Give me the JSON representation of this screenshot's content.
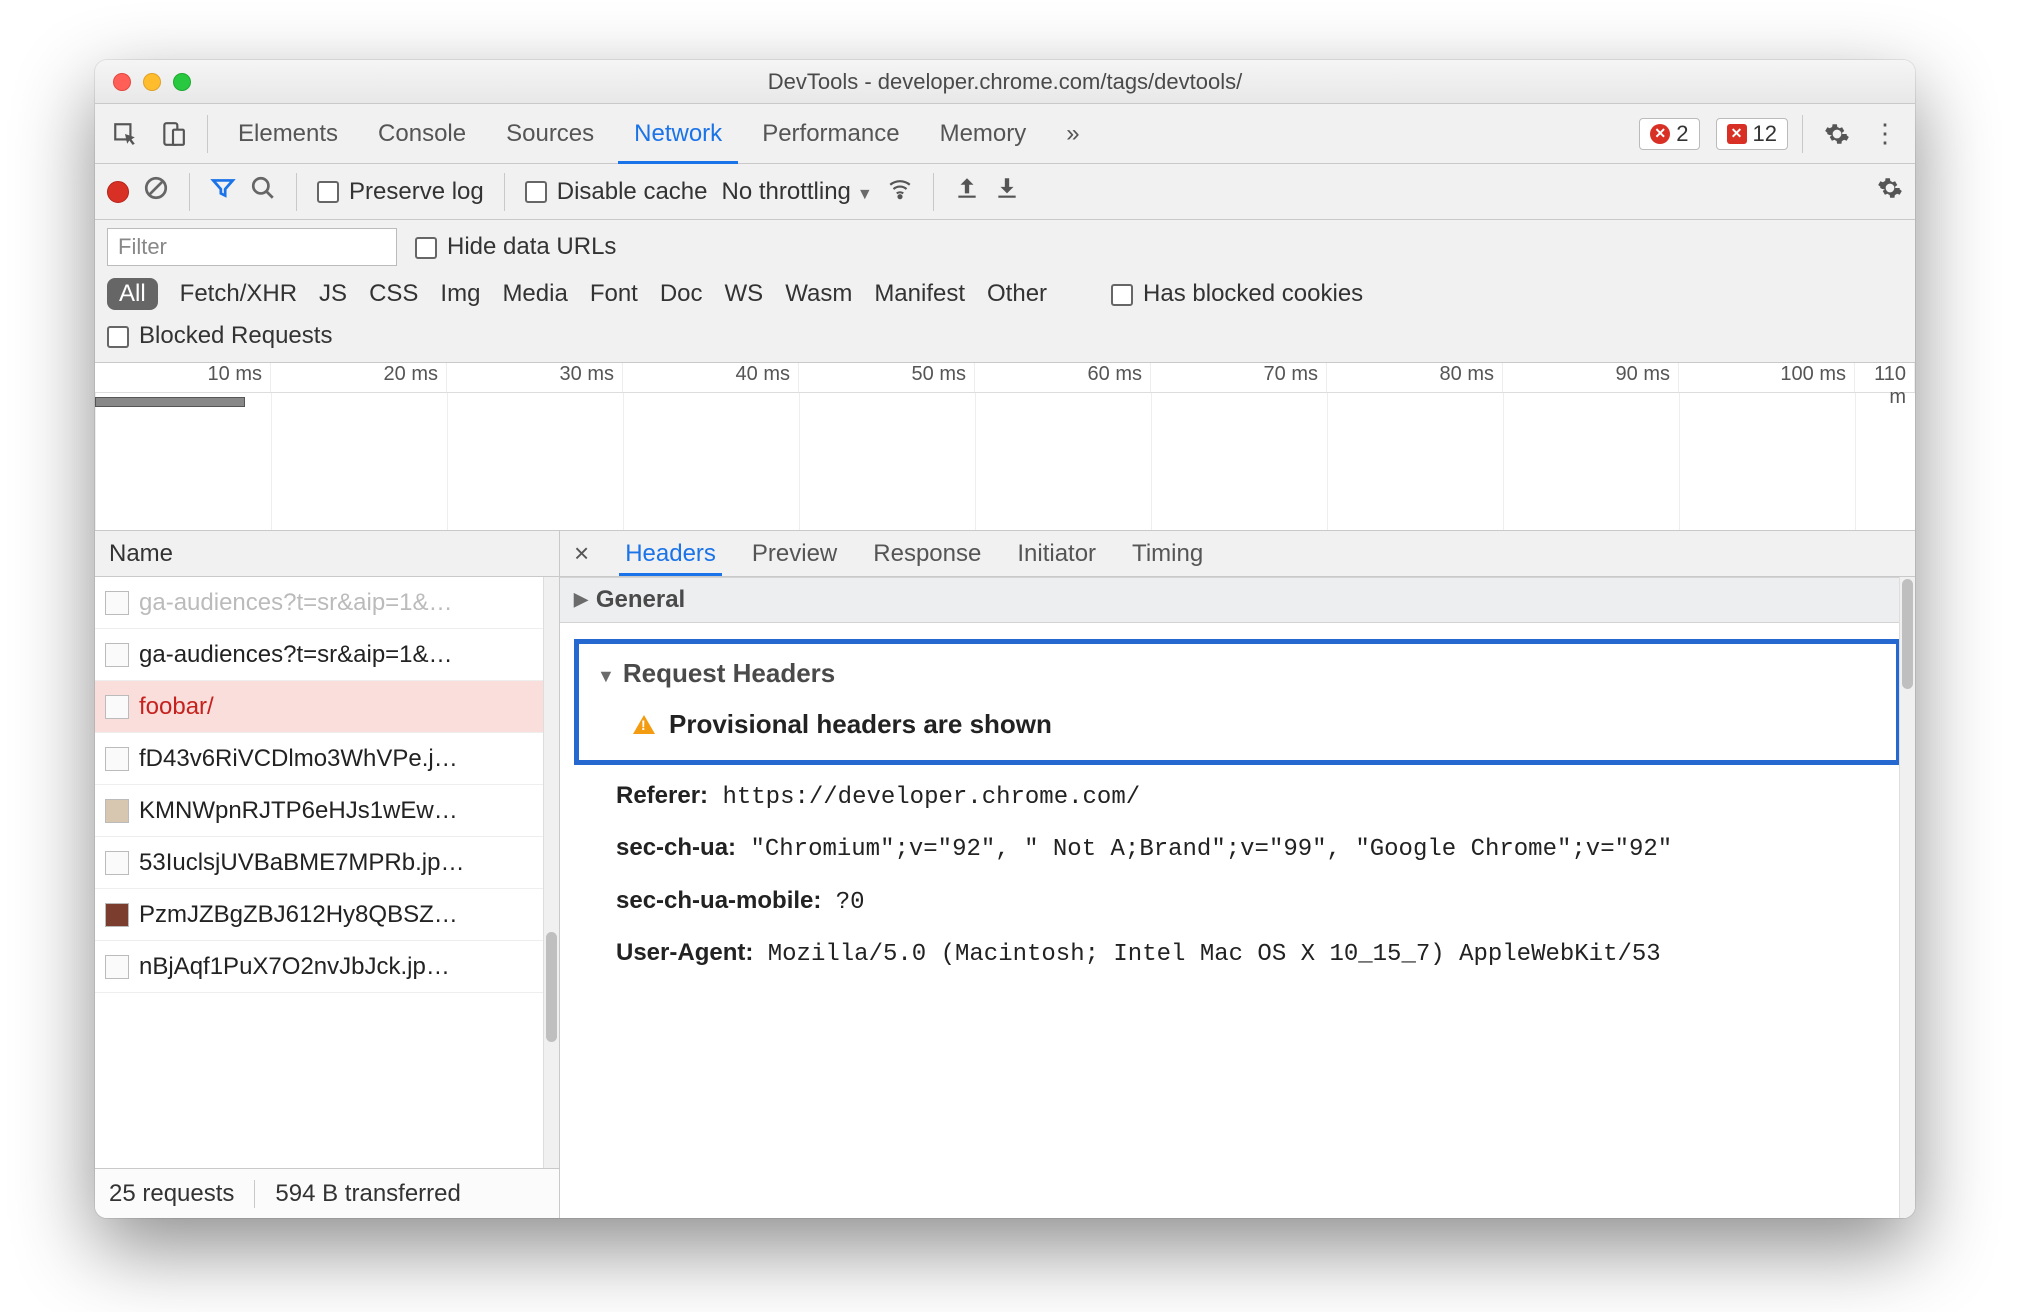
{
  "window": {
    "title": "DevTools - developer.chrome.com/tags/devtools/"
  },
  "topbar": {
    "tabs": [
      "Elements",
      "Console",
      "Sources",
      "Network",
      "Performance",
      "Memory"
    ],
    "active": "Network",
    "overflow": "»",
    "error_count": "2",
    "issue_count": "12"
  },
  "nettoolbar": {
    "preserve_log": "Preserve log",
    "disable_cache": "Disable cache",
    "throttling": "No throttling"
  },
  "filter": {
    "placeholder": "Filter",
    "hide_data_urls": "Hide data URLs",
    "types": [
      "All",
      "Fetch/XHR",
      "JS",
      "CSS",
      "Img",
      "Media",
      "Font",
      "Doc",
      "WS",
      "Wasm",
      "Manifest",
      "Other"
    ],
    "active_type": "All",
    "has_blocked_cookies": "Has blocked cookies",
    "blocked_requests": "Blocked Requests"
  },
  "timeline": {
    "ticks": [
      "10 ms",
      "20 ms",
      "30 ms",
      "40 ms",
      "50 ms",
      "60 ms",
      "70 ms",
      "80 ms",
      "90 ms",
      "100 ms",
      "110 m"
    ]
  },
  "requests_panel": {
    "header": "Name",
    "items": [
      {
        "name": "ga-audiences?t=sr&aip=1&…",
        "status": "cut"
      },
      {
        "name": "ga-audiences?t=sr&aip=1&…",
        "status": "normal"
      },
      {
        "name": "foobar/",
        "status": "error"
      },
      {
        "name": "fD43v6RiVCDlmo3WhVPe.j…",
        "status": "normal"
      },
      {
        "name": "KMNWpnRJTP6eHJs1wEw…",
        "status": "normal"
      },
      {
        "name": "53IuclsjUVBaBME7MPRb.jp…",
        "status": "normal"
      },
      {
        "name": "PzmJZBgZBJ612Hy8QBSZ…",
        "status": "normal"
      },
      {
        "name": "nBjAqf1PuX7O2nvJbJck.jp…",
        "status": "normal"
      }
    ],
    "status": {
      "requests": "25 requests",
      "transferred": "594 B transferred"
    }
  },
  "detail": {
    "tabs": [
      "Headers",
      "Preview",
      "Response",
      "Initiator",
      "Timing"
    ],
    "active": "Headers",
    "sections": {
      "general": "General",
      "request_headers": "Request Headers",
      "provisional": "Provisional headers are shown"
    },
    "headers": {
      "referer_k": "Referer:",
      "referer_v": "https://developer.chrome.com/",
      "secchua_k": "sec-ch-ua:",
      "secchua_v": "\"Chromium\";v=\"92\", \" Not A;Brand\";v=\"99\", \"Google Chrome\";v=\"92\"",
      "secchuamobile_k": "sec-ch-ua-mobile:",
      "secchuamobile_v": "?0",
      "useragent_k": "User-Agent:",
      "useragent_v": "Mozilla/5.0 (Macintosh; Intel Mac OS X 10_15_7) AppleWebKit/53"
    }
  }
}
